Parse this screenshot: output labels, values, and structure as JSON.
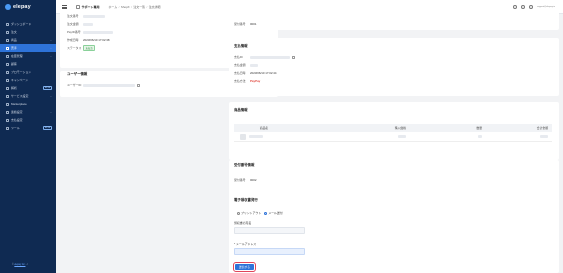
{
  "brand": {
    "name": "elepay"
  },
  "sidebar": {
    "items": [
      {
        "label": "ダッシュボード",
        "active": false,
        "chevron": ""
      },
      {
        "label": "注文",
        "active": false,
        "chevron": ""
      },
      {
        "label": "商品",
        "active": false,
        "chevron": "⌄"
      },
      {
        "label": "売手",
        "active": true,
        "chevron": "⌄"
      },
      {
        "label": "在庫管理",
        "active": false,
        "chevron": "⌄"
      },
      {
        "label": "顧客",
        "active": false,
        "chevron": ""
      },
      {
        "label": "プロモーション",
        "active": false,
        "chevron": ""
      },
      {
        "label": "キャンペーン",
        "active": false,
        "chevron": ""
      },
      {
        "label": "解析",
        "active": false,
        "chevron": "",
        "badge": "BETA"
      },
      {
        "label": "サービス設定",
        "active": false,
        "chevron": "⌄"
      },
      {
        "label": "Marketplace",
        "active": false,
        "chevron": ""
      },
      {
        "label": "連絡設定",
        "active": false,
        "chevron": "⌄"
      },
      {
        "label": "支払設定",
        "active": false,
        "chevron": ""
      },
      {
        "label": "ツール",
        "active": false,
        "chevron": "",
        "badge": "BETA"
      }
    ],
    "footer_prefix": "©",
    "footer_link": "elepay Inc."
  },
  "topbar": {
    "store_name": "サポート専用",
    "breadcrumb": [
      "ホーム",
      "ShopX",
      "注文一覧",
      "注文詳細"
    ],
    "user_name": "",
    "user_mail": "support@elepay.io"
  },
  "order_info": {
    "rows": [
      {
        "label": "注文番号",
        "value": ""
      },
      {
        "label": "PayID番号",
        "value": ""
      },
      {
        "label": "作成日時",
        "value": "2023/06/10 17:02:38"
      },
      {
        "label": "ステータス",
        "value": "支払済"
      }
    ]
  },
  "user_info": {
    "title": "ユーザー情報",
    "rows": [
      {
        "label": "ユーザーID",
        "value": ""
      }
    ]
  },
  "right_top": {
    "rows": [
      {
        "label": "受付番号",
        "value": "0001"
      }
    ]
  },
  "payment_info": {
    "title": "支払情報",
    "rows": [
      {
        "label": "支払ID",
        "value": "",
        "copy": true
      },
      {
        "label": "支払金額",
        "value": ""
      },
      {
        "label": "支払日時",
        "value": "2023/06/10 17:02:44"
      },
      {
        "label": "支払方法",
        "value": "PayPay",
        "red": true
      }
    ]
  },
  "product_info": {
    "title": "商品情報",
    "columns": [
      "商品名",
      "購入価格",
      "数量",
      "合計金額"
    ],
    "rows": [
      {
        "name": "",
        "price": "",
        "qty": "",
        "total": ""
      }
    ]
  },
  "reception_info": {
    "title": "受付番号情報",
    "rows": [
      {
        "label": "受付番号",
        "value": "0002"
      }
    ]
  },
  "receipt": {
    "title": "電子領収書発行",
    "radio_print": "プリントアウト",
    "radio_mail": "メール送付",
    "name_label": "領収書の宛名",
    "email_label": "* メールアドレス",
    "send_button": "送信する"
  }
}
